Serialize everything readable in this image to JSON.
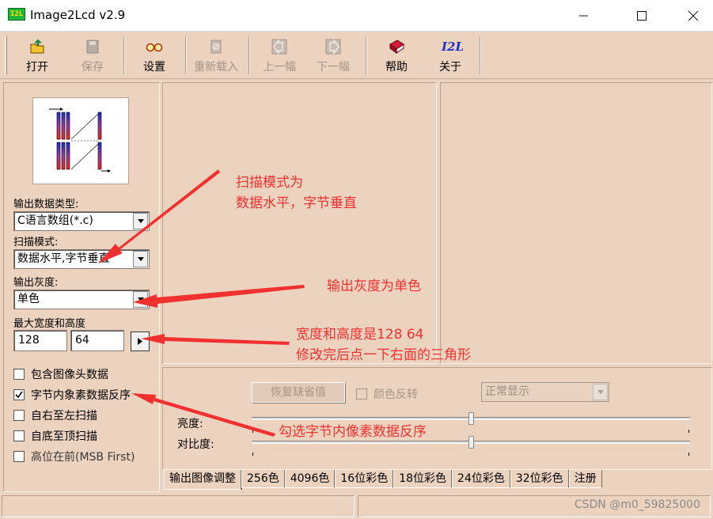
{
  "window": {
    "icon_text": "I2L",
    "title": "Image2Lcd v2.9"
  },
  "toolbar": {
    "open": "打开",
    "save": "保存",
    "settings": "设置",
    "reload": "重新载入",
    "prev": "上一幅",
    "next": "下一幅",
    "help": "帮助",
    "about": "关于",
    "about_icon_text": "I2L"
  },
  "left": {
    "output_type_label": "输出数据类型:",
    "output_type_value": "C语言数组(*.c)",
    "scan_mode_label": "扫描模式:",
    "scan_mode_value": "数据水平,字节垂直",
    "gray_label": "输出灰度:",
    "gray_value": "单色",
    "size_label": "最大宽度和高度",
    "width_value": "128",
    "height_value": "64",
    "checkboxes": [
      {
        "label": "包含图像头数据",
        "checked": false
      },
      {
        "label": "字节内象素数据反序",
        "checked": true
      },
      {
        "label": "自右至左扫描",
        "checked": false
      },
      {
        "label": "自底至顶扫描",
        "checked": false
      },
      {
        "label": "高位在前(MSB First)",
        "checked": false
      }
    ]
  },
  "adjust": {
    "restore_label": "恢复缺省值",
    "invert_label": "颜色反转",
    "mode_value": "正常显示",
    "brightness_label": "亮度:",
    "contrast_label": "对比度:",
    "brightness_level": 0.5,
    "contrast_level": 0.5
  },
  "tabs": [
    "输出图像调整",
    "256色",
    "4096色",
    "16位彩色",
    "18位彩色",
    "24位彩色",
    "32位彩色",
    "注册"
  ],
  "status": {
    "watermark": "CSDN @m0_59825000"
  },
  "annotations": {
    "scan_note_line1": "扫描模式为",
    "scan_note_line2": "数据水平，字节垂直",
    "gray_note": "输出灰度为单色",
    "size_note_line1": "宽度和高度是128 64",
    "size_note_line2": "修改完后点一下右面的三角形",
    "reverse_note": "勾选字节内像素数据反序"
  },
  "colors": {
    "annotation": "#f0312f",
    "panel": "#ecd3bf"
  }
}
